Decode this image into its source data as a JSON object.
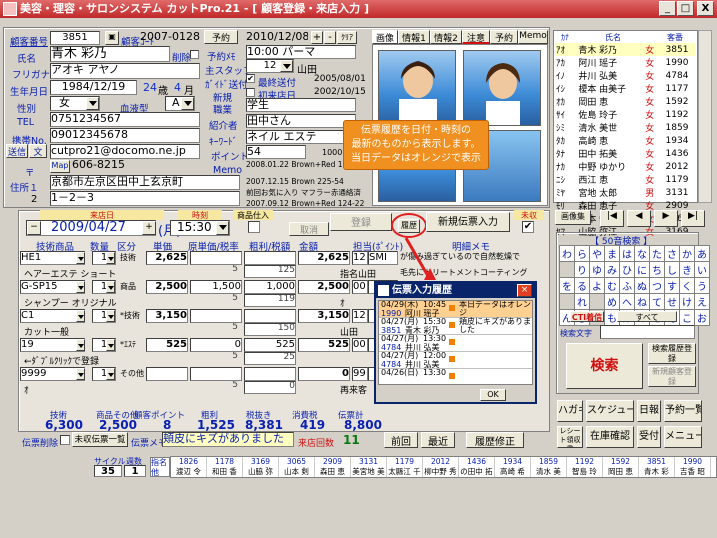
{
  "window": {
    "title": "美容・理容・サロンシステム カットPro.21 - [ 顧客登録・来店入力 ]",
    "controls": [
      "_",
      "□",
      "X"
    ],
    "sub_controls": [
      "_",
      "□",
      "X"
    ]
  },
  "customer": {
    "no_label": "顧客番号",
    "no": "3851",
    "code_label": "顧客ｺｰﾄﾞ",
    "code": "2007-0128",
    "yoyaku": "予約",
    "name_label": "氏名",
    "name": "青木 彩乃",
    "sakujo": "削除",
    "furigana_label": "フリガナ",
    "furigana": "アオキ アヤノ",
    "birth_label": "生年月日",
    "birth": "1984/12/19",
    "age": "24",
    "age_unit": "歳",
    "month": "4",
    "month_unit": "月",
    "sex_label": "性別",
    "sex": "女",
    "blood_label": "血液型",
    "blood": "A",
    "tel_label": "TEL",
    "tel": "0751234567",
    "mobile_label": "携帯No.",
    "mobile": "09012345678",
    "send_btn": "送信",
    "mail_btn": "文",
    "email": "cutpro21@docomo.ne.jp",
    "zip_label": "〒",
    "map_btn": "Map",
    "zip": "606-8215",
    "addr_label": "住所１",
    "addr1": "京都市左京区田中上玄京町",
    "addr2_no": "2",
    "addr2": "1－2－3"
  },
  "visit": {
    "date": "2010/12/08",
    "plus": "+",
    "minus": "-",
    "clear": "ｸﾘｱ",
    "yoyaku_memo_label": "予約ﾒﾓ",
    "yoyaku_memo": "10:00 パーマ",
    "staff_label": "主スタッフ",
    "staff_no": "12",
    "staff": "山田",
    "gift_label": "ｶﾞｲﾄﾞ送付",
    "last_label": "最終送付",
    "last_date": "2005/08/01",
    "new_label": "新規",
    "first_label": "初来店日",
    "first_date": "2002/10/15",
    "job_label": "職業",
    "job": "学生",
    "intro_label": "紹介者",
    "intro": "田中さん",
    "keyword_label": "ｷｰﾜｰﾄﾞ",
    "keyword": "ネイル エステ",
    "point_label": "ポイント",
    "point": "54",
    "point_right": "1000",
    "memo_label": "Memo",
    "memo_lines": [
      "2008.01.22 Brown+Red 15",
      "2007.12.15 Brown 225-54",
      "前回お気に入り マフラー赤通絡済",
      "2007.09.12 Brown+Red 124-22"
    ]
  },
  "tabs": [
    "画像",
    "情報1",
    "情報2",
    "注意",
    "予約",
    "Memo"
  ],
  "tooltip": {
    "text1": "伝票履歴を日付・時刻の",
    "text2": "最新のものから表示します。",
    "text3": "当日データはオレンジで表示"
  },
  "slip": {
    "visit_label": "来店日",
    "date": "2009/04/27",
    "weekday": "(月)",
    "time_label": "時刻",
    "time": "15:30",
    "product_label": "商品仕入",
    "register_btn": "登録",
    "cancel_btn": "取消",
    "history_btn": "履歴",
    "new_slip_btn": "新規伝票入力",
    "unpaid_label": "未収",
    "col_headers": [
      "技術商品",
      "数量",
      "区分",
      "単価",
      "原単価/税率",
      "粗利/税額",
      "金額",
      "担当(ﾎﾟｲﾝﾄ)",
      "明細メモ"
    ],
    "rows": [
      {
        "code": "HE1",
        "qty": "1",
        "kubun": "技術",
        "price": "2,625",
        "rate": "",
        "gross": "",
        "amount": "2,625",
        "tanto_no": "12",
        "tanto": "SMI",
        "memo": "が傷み過ぎているので自然乾燥で",
        "name": "ヘアーエステ ショート",
        "rate2": "5",
        "tax": "125",
        "tanto2": "指名山田",
        "memo2": "毛先にトリートメントコーティング"
      },
      {
        "code": "G-SP15",
        "qty": "1",
        "kubun": "商品",
        "price": "2,500",
        "rate": "1,500",
        "gross": "1,000",
        "amount": "2,500",
        "tanto_no": "00",
        "tanto": "",
        "memo": "",
        "name": "シャンプー オリジナル",
        "rate2": "5",
        "tax": "119",
        "tanto2": "ｵ"
      },
      {
        "code": "C1",
        "qty": "1",
        "kubun": "*技術",
        "price": "3,150",
        "rate": "",
        "gross": "",
        "amount": "3,150",
        "tanto_no": "12",
        "tanto": "",
        "memo": "",
        "name": "カット一般",
        "rate2": "5",
        "tax": "150",
        "tanto2": "山田"
      },
      {
        "code": "19",
        "qty": "1",
        "kubun": "*ｴｽﾃ",
        "price": "525",
        "rate": "0",
        "gross": "525",
        "amount": "525",
        "tanto_no": "00",
        "tanto": "",
        "memo": "",
        "name": "←ﾀﾞﾌﾞﾙｸﾘｯｸで登録",
        "rate2": "5",
        "tax": "25",
        "tanto2": ""
      },
      {
        "code": "9999",
        "qty": "1",
        "kubun": "その他",
        "price": "",
        "rate": "",
        "gross": "",
        "amount": "0",
        "tanto_no": "99",
        "tanto": "",
        "memo": "",
        "name": "ｵ",
        "rate2": "5",
        "tax": "0",
        "tanto2": "再来客"
      }
    ],
    "totals_headers": [
      "技術",
      "商品その他",
      "顧客ポイント",
      "粗利",
      "税抜き",
      "消費税",
      "伝票計"
    ],
    "totals": [
      "6,300",
      "2,500",
      "8",
      "1,525",
      "8,381",
      "419",
      "8,800"
    ],
    "slip_delete": "伝票削除",
    "unpaid_list_btn": "未収伝票一覧",
    "slip_memo_label": "伝票メモ",
    "slip_memo": "頬皮にキズがありました",
    "visit_count_label": "来店回数",
    "visit_count": "11",
    "prev_btn": "前回",
    "latest_btn": "最近",
    "fix_btn": "履歴修正"
  },
  "bottom": {
    "cycle_label": "サイクル",
    "kenbu_label": "週数",
    "cycle": "35",
    "kenbu": "1",
    "mikata_label": "指名他",
    "names": [
      {
        "no": "1826",
        "name": "渡辺 令"
      },
      {
        "no": "1178",
        "name": "和田 香"
      },
      {
        "no": "3169",
        "name": "山脇 弥"
      },
      {
        "no": "3065",
        "name": "山本 剣"
      },
      {
        "no": "2909",
        "name": "森田 恵"
      },
      {
        "no": "3131",
        "name": "美宮地 美"
      },
      {
        "no": "1179",
        "name": "太縣江 千"
      },
      {
        "no": "2012",
        "name": "柳中野 秀"
      },
      {
        "no": "1436",
        "name": "の田中 拓"
      },
      {
        "no": "1934",
        "name": "高崎 希"
      },
      {
        "no": "1859",
        "name": "清水 美"
      },
      {
        "no": "1192",
        "name": "智島 玲"
      },
      {
        "no": "1592",
        "name": "岡田 恵"
      },
      {
        "no": "3851",
        "name": "青木 彩"
      },
      {
        "no": "1990",
        "name": "吉香 昭"
      }
    ]
  },
  "history": {
    "title": "伝票入力履歴",
    "rows": [
      {
        "date": "04/29(木)",
        "time": "10:45",
        "no": "1990",
        "name": "阿川 瑶子",
        "memo": "本日データはオレンジ",
        "today": true
      },
      {
        "date": "04/27(月)",
        "time": "15:30",
        "no": "3851",
        "name": "青木 彩乃",
        "memo": "頬皮にキズがありました"
      },
      {
        "date": "04/27(月)",
        "time": "13:30",
        "no": "4784",
        "name": "井川 弘美",
        "memo": ""
      },
      {
        "date": "04/27(月)",
        "time": "12:00",
        "no": "4784",
        "name": "井川 弘美",
        "memo": ""
      },
      {
        "date": "04/26(日)",
        "time": "13:30",
        "no": "",
        "name": "",
        "memo": ""
      }
    ],
    "ok": "OK"
  },
  "right": {
    "headers": [
      "ｶﾅ",
      "氏名",
      "客番"
    ],
    "list": [
      {
        "k": "ｱｵ",
        "n": "青木 彩乃",
        "s": "女",
        "no": "3851"
      },
      {
        "k": "ｱｶ",
        "n": "阿川 瑶子",
        "s": "女",
        "no": "1990"
      },
      {
        "k": "ｲﾉ",
        "n": "井川 弘美",
        "s": "女",
        "no": "4784"
      },
      {
        "k": "ｲｼ",
        "n": "榎本 由美子",
        "s": "女",
        "no": "1177"
      },
      {
        "k": "ｵｶ",
        "n": "岡田 恵",
        "s": "女",
        "no": "1592"
      },
      {
        "k": "ｻｲ",
        "n": "佐島 玲子",
        "s": "女",
        "no": "1192"
      },
      {
        "k": "ｼﾐ",
        "n": "清水 美世",
        "s": "女",
        "no": "1859"
      },
      {
        "k": "ﾀｶ",
        "n": "高崎 恵",
        "s": "女",
        "no": "1934"
      },
      {
        "k": "ﾀﾅ",
        "n": "田中 拓美",
        "s": "女",
        "no": "1436"
      },
      {
        "k": "ﾅｶ",
        "n": "中野 ゆかり",
        "s": "女",
        "no": "2012"
      },
      {
        "k": "ﾆｼ",
        "n": "西江 恵",
        "s": "女",
        "no": "1179"
      },
      {
        "k": "ﾐﾔ",
        "n": "宮地 太郎",
        "s": "男",
        "no": "3131"
      },
      {
        "k": "ﾓﾘ",
        "n": "森田 恵子",
        "s": "女",
        "no": "2909"
      },
      {
        "k": "ﾔﾏ",
        "n": "山本 敏子",
        "s": "女",
        "no": "3065"
      },
      {
        "k": "ﾔﾏ",
        "n": "山脇 弥江",
        "s": "女",
        "no": "3169"
      }
    ],
    "image_btn": "画像集",
    "nav": [
      "|◀",
      "◀",
      "▶",
      "▶|"
    ],
    "gojuon_label": "【 50音検索 】",
    "kana_rows": [
      [
        "わ",
        "ら",
        "や",
        "ま",
        "は",
        "な",
        "た",
        "さ",
        "か",
        "あ"
      ],
      [
        "",
        "り",
        "ゆ",
        "み",
        "ひ",
        "に",
        "ち",
        "し",
        "き",
        "い"
      ],
      [
        "を",
        "る",
        "よ",
        "む",
        "ふ",
        "ぬ",
        "つ",
        "す",
        "く",
        "う"
      ],
      [
        "",
        "れ",
        "",
        "め",
        "へ",
        "ね",
        "て",
        "せ",
        "け",
        "え"
      ],
      [
        "ん",
        "ろ",
        "",
        "も",
        "ほ",
        "の",
        "と",
        "そ",
        "こ",
        "お"
      ]
    ],
    "cti_label": "CTI着信",
    "all_label": "すべて",
    "search_label": "検索文字",
    "search_btn": "検索",
    "search_reg": "検索履歴登録",
    "new_reg": "新規顧客登録",
    "bottom_btns": [
      [
        "ハガキ",
        "スケジュール",
        "日報",
        "予約一覧"
      ],
      [
        "レシート領収書",
        "在庫確認",
        "受付",
        "メニュー"
      ]
    ]
  }
}
